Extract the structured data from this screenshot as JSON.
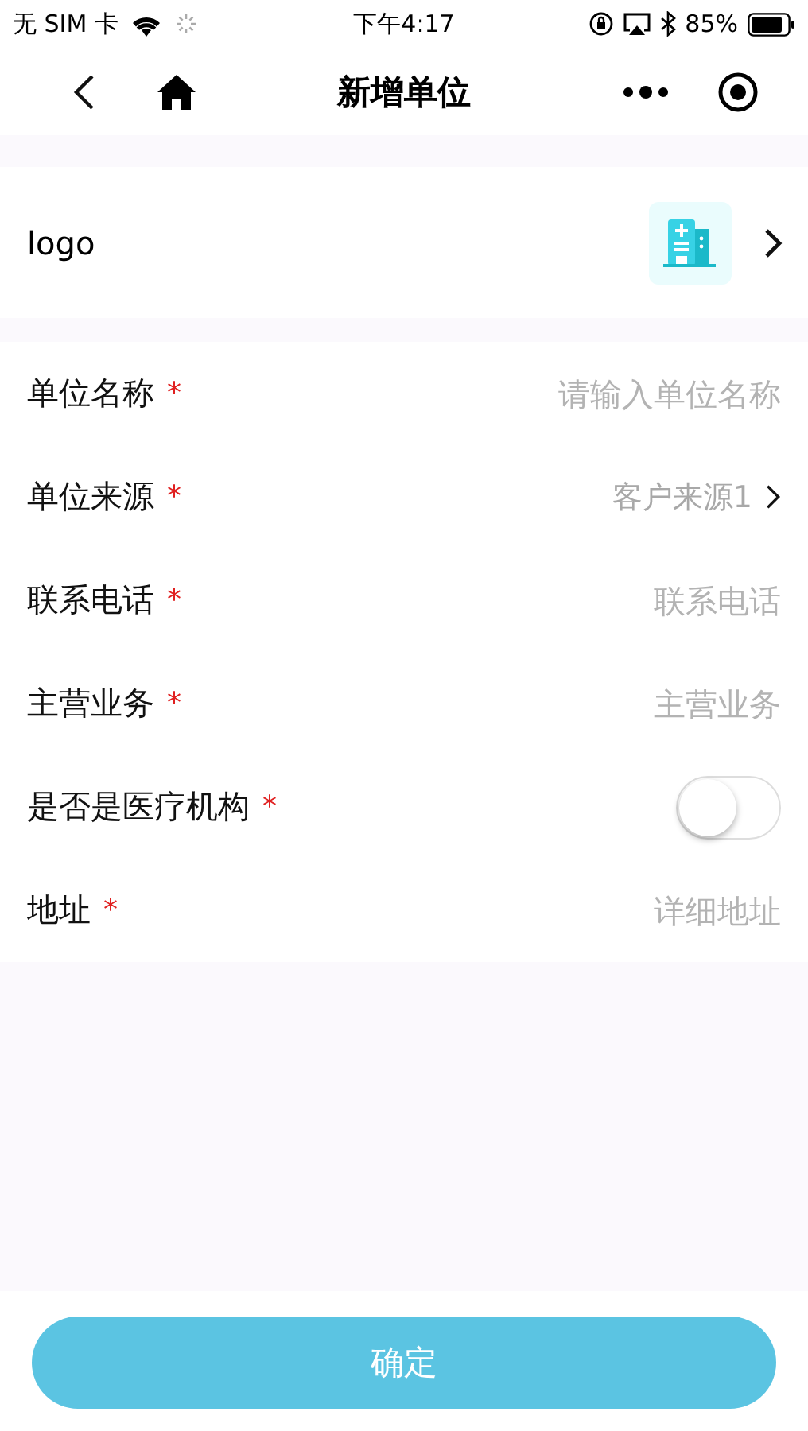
{
  "status_bar": {
    "carrier": "无 SIM 卡",
    "time": "下午4:17",
    "battery": "85%"
  },
  "nav": {
    "title": "新增单位"
  },
  "logo_row": {
    "label": "logo"
  },
  "required_mark": "*",
  "fields": [
    {
      "kind": "input",
      "label": "单位名称",
      "required": true,
      "placeholder": "请输入单位名称"
    },
    {
      "kind": "select",
      "label": "单位来源",
      "required": true,
      "value": "客户来源1"
    },
    {
      "kind": "input",
      "label": "联系电话",
      "required": true,
      "placeholder": "联系电话"
    },
    {
      "kind": "input",
      "label": "主营业务",
      "required": true,
      "placeholder": "主营业务"
    },
    {
      "kind": "switch",
      "label": "是否是医疗机构",
      "required": true,
      "on": false
    },
    {
      "kind": "input",
      "label": "地址",
      "required": true,
      "placeholder": "详细地址"
    }
  ],
  "submit": {
    "label": "确定"
  }
}
